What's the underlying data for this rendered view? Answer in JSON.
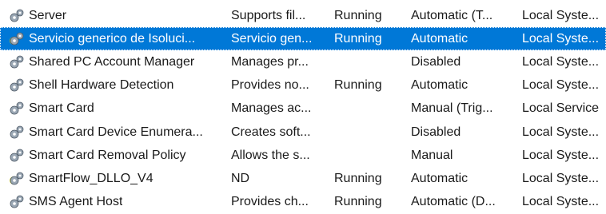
{
  "columns_order": [
    "name",
    "description",
    "status",
    "startup",
    "logon"
  ],
  "services": [
    {
      "name": "Server",
      "description": "Supports fil...",
      "status": "Running",
      "startup": "Automatic (T...",
      "logon": "Local Syste...",
      "icon": "gear-service-icon",
      "selected": false
    },
    {
      "name": "Servicio generico de Isoluci...",
      "description": "Servicio gen...",
      "status": "Running",
      "startup": "Automatic",
      "logon": "Local Syste...",
      "icon": "gear-service-icon",
      "selected": true
    },
    {
      "name": "Shared PC Account Manager",
      "description": "Manages pr...",
      "status": "",
      "startup": "Disabled",
      "logon": "Local Syste...",
      "icon": "gear-service-icon",
      "selected": false
    },
    {
      "name": "Shell Hardware Detection",
      "description": "Provides no...",
      "status": "Running",
      "startup": "Automatic",
      "logon": "Local Syste...",
      "icon": "gear-service-icon",
      "selected": false
    },
    {
      "name": "Smart Card",
      "description": "Manages ac...",
      "status": "",
      "startup": "Manual (Trig...",
      "logon": "Local Service",
      "icon": "gear-service-icon",
      "selected": false
    },
    {
      "name": "Smart Card Device Enumera...",
      "description": "Creates soft...",
      "status": "",
      "startup": "Disabled",
      "logon": "Local Syste...",
      "icon": "gear-service-icon",
      "selected": false
    },
    {
      "name": "Smart Card Removal Policy",
      "description": "Allows the s...",
      "status": "",
      "startup": "Manual",
      "logon": "Local Syste...",
      "icon": "gear-service-icon",
      "selected": false
    },
    {
      "name": "SmartFlow_DLLO_V4",
      "description": "ND",
      "status": "Running",
      "startup": "Automatic",
      "logon": "Local Syste...",
      "icon": "gear-service-icon",
      "selected": false
    },
    {
      "name": "SMS Agent Host",
      "description": "Provides ch...",
      "status": "Running",
      "startup": "Automatic (D...",
      "logon": "Local Syste...",
      "icon": "gear-service-icon",
      "selected": false
    }
  ],
  "colors": {
    "selection": "#0078d7",
    "gear_fill": "#9aa7b4",
    "gear_highlight": "#f2e600"
  }
}
